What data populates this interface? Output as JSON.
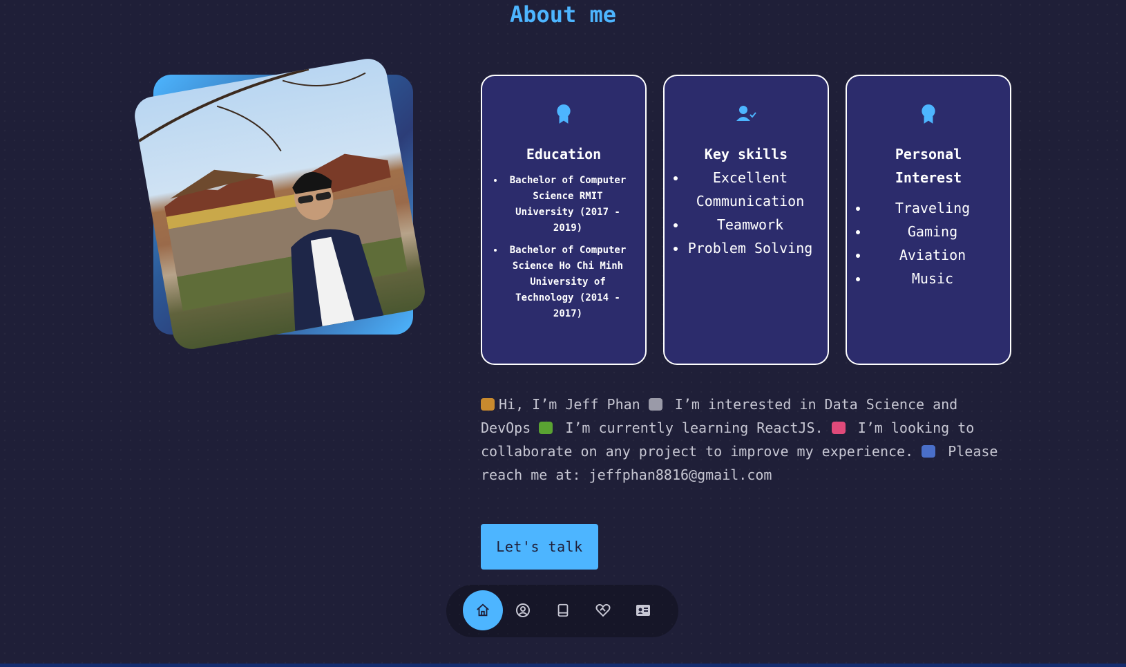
{
  "section": {
    "title": "About me"
  },
  "cards": [
    {
      "icon": "award-icon",
      "title": "Education",
      "items": [
        "Bachelor of Computer Science RMIT University (2017 - 2019)",
        "Bachelor of Computer Science Ho Chi Minh University of Technology (2014 - 2017)"
      ]
    },
    {
      "icon": "user-check-icon",
      "title": "Key skills",
      "items": [
        "Excellent Communication",
        "Teamwork",
        "Problem Solving"
      ]
    },
    {
      "icon": "award-icon",
      "title": "Personal Interest",
      "items": [
        "Traveling",
        "Gaming",
        "Aviation",
        "Music"
      ]
    }
  ],
  "intro": {
    "segments": [
      "Hi, I’m Jeff Phan ",
      " I’m interested in Data Science and DevOps ",
      " I’m currently learning ReactJS. ",
      " I’m looking to collaborate on any project to improve my experience. ",
      " Please reach me at: jeffphan8816@gmail.com"
    ]
  },
  "cta": {
    "label": "Let's talk"
  },
  "nav": {
    "items": [
      {
        "icon": "home-icon",
        "active": true
      },
      {
        "icon": "user-icon",
        "active": false
      },
      {
        "icon": "book-icon",
        "active": false
      },
      {
        "icon": "heart-handshake-icon",
        "active": false
      },
      {
        "icon": "contact-card-icon",
        "active": false
      }
    ]
  },
  "colors": {
    "background": "#1f1f38",
    "primary": "#4db5ff",
    "card": "#2c2c6c",
    "text_light": "#c7c7d3"
  }
}
